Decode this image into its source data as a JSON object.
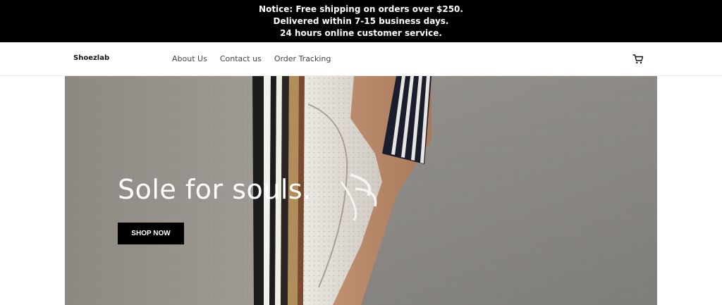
{
  "notice": {
    "lines": [
      "Notice: Free shipping on orders over $250.",
      "Delivered within 7-15 business days.",
      "24 hours online customer service."
    ]
  },
  "header": {
    "logo": "Shoezlab",
    "nav": [
      "About Us",
      "Contact us",
      "Order Tracking"
    ],
    "cart_icon": "cart-icon"
  },
  "hero": {
    "title": "Sole for souls.",
    "button_label": "SHOP NOW",
    "image": "shoe-photo"
  },
  "colors": {
    "notice_bg": "#000000",
    "button_bg": "#000000",
    "hero_text": "#ffffff"
  }
}
